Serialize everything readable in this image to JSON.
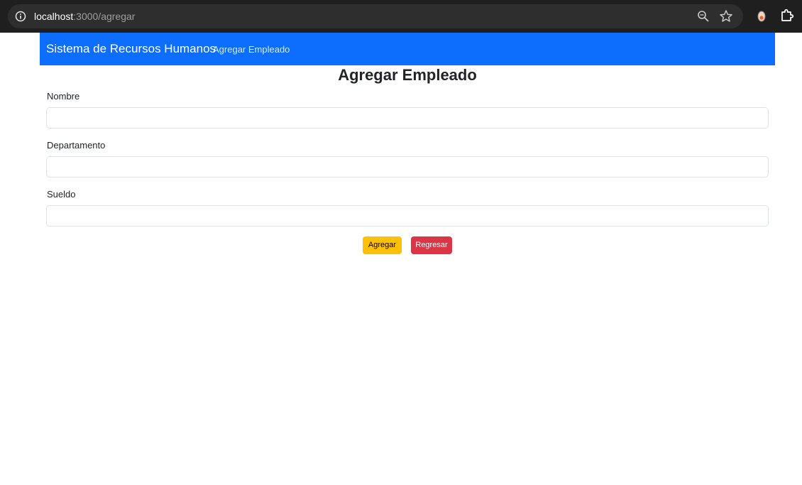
{
  "browser": {
    "url_host": "localhost",
    "url_rest": ":3000/agregar",
    "icons": [
      "site-info-icon",
      "zoom-icon",
      "bookmark-star-icon",
      "extension-icon",
      "extensions-puzzle-icon"
    ]
  },
  "navbar": {
    "brand": "Sistema de Recursos Humanos",
    "link": "Agregar Empleado",
    "color": "#0d6efd"
  },
  "form": {
    "title": "Agregar Empleado",
    "fields": [
      {
        "label": "Nombre",
        "value": ""
      },
      {
        "label": "Departamento",
        "value": ""
      },
      {
        "label": "Sueldo",
        "value": ""
      }
    ],
    "submit_label": "Agregar",
    "back_label": "Regresar",
    "submit_color": "#ffc107",
    "back_color": "#dc3545"
  }
}
